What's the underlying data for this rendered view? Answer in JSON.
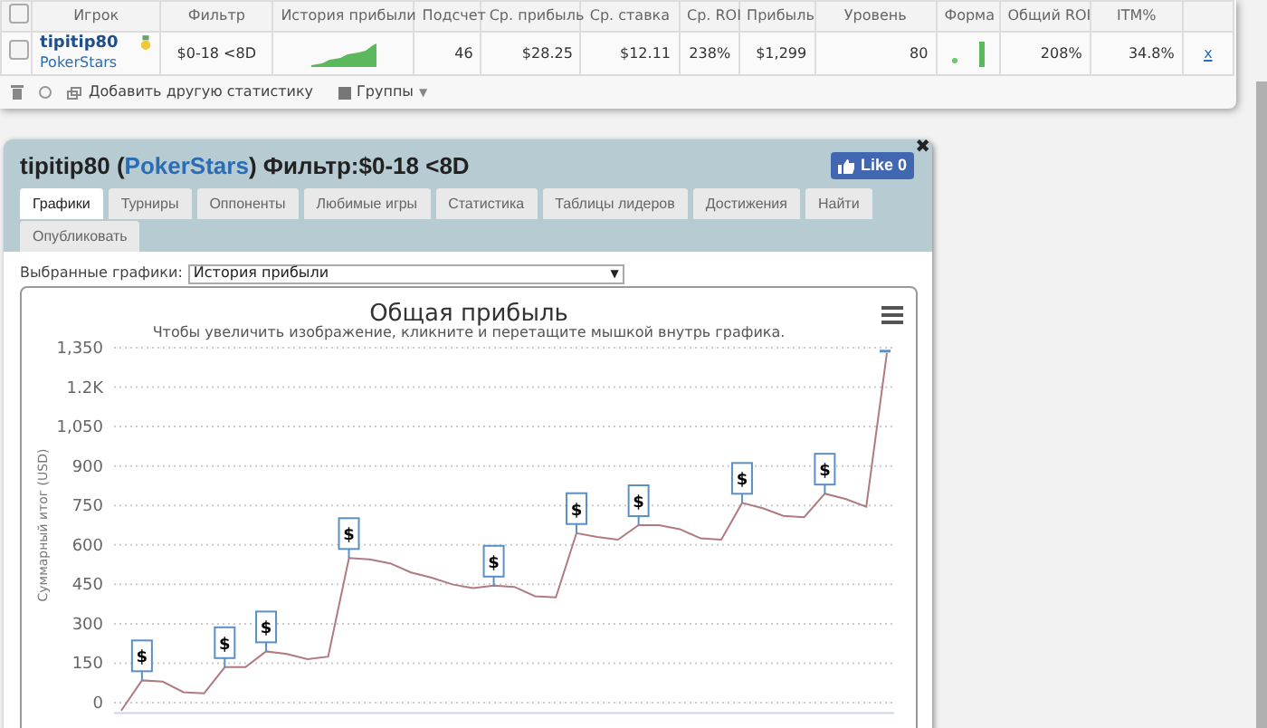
{
  "table": {
    "header_checkbox": {
      "checked": false
    },
    "columns": [
      "Игрок",
      "Фильтр",
      "История прибыли",
      "Подсчет",
      "Ср. прибыль",
      "Ср. ставка",
      "Ср. ROI",
      "Прибыль",
      "Уровень",
      "Форма",
      "Общий ROI",
      "ITM%"
    ],
    "rows": [
      {
        "checked": false,
        "player": "tipitip80",
        "site": "PokerStars",
        "filter": "$0-18 <8D",
        "count": "46",
        "avg_profit": "$28.25",
        "avg_stake": "$12.11",
        "avg_roi": "238%",
        "profit": "$1,299",
        "level": "80",
        "total_roi": "208%",
        "itm": "34.8%",
        "remove": "x"
      }
    ]
  },
  "toolbar": {
    "add_stat": "Добавить другую статистику",
    "groups": "Группы",
    "groups_caret": "▼"
  },
  "panel": {
    "player": "tipitip80",
    "open": " (",
    "site": "PokerStars",
    "close": ")",
    "filter": "Фильтр:$0-18 <8D",
    "like": "Like 0",
    "close_glyph": "✖",
    "tabs": [
      {
        "label": "Графики",
        "selected": true
      },
      {
        "label": "Турниры",
        "selected": false
      },
      {
        "label": "Оппоненты",
        "selected": false
      },
      {
        "label": "Любимые игры",
        "selected": false
      },
      {
        "label": "Статистика",
        "selected": false
      },
      {
        "label": "Таблицы лидеров",
        "selected": false
      },
      {
        "label": "Достижения",
        "selected": false
      },
      {
        "label": "Найти",
        "selected": false
      },
      {
        "label": "Опубликовать",
        "selected": false
      }
    ],
    "chart_select": {
      "label": "Выбранные графики:",
      "value": "История прибыли",
      "caret": "▼"
    },
    "chart": {
      "title": "Общая прибыль",
      "subtitle": "Чтобы увеличить изображение, кликните и перетащите мышкой внутрь графика.",
      "chart_data": {
        "type": "line",
        "ylabel": "Суммарный итог (USD)",
        "grid": true,
        "ylim": [
          -40,
          1350
        ],
        "yticks": [
          0,
          150,
          300,
          450,
          600,
          750,
          900,
          {
            "value": 1050,
            "label": "1,050"
          },
          {
            "value": 1200,
            "label": "1.2K"
          },
          {
            "value": 1350,
            "label": "1,350"
          }
        ],
        "series": [
          {
            "color": "#b07a80",
            "values": [
              -30,
              85,
              80,
              40,
              35,
              135,
              135,
              195,
              185,
              165,
              175,
              550,
              545,
              530,
              495,
              475,
              450,
              435,
              445,
              440,
              405,
              400,
              645,
              630,
              620,
              675,
              675,
              660,
              625,
              620,
              760,
              740,
              710,
              705,
              795,
              775,
              745,
              1330
            ]
          }
        ],
        "annotations": [
          {
            "y": 85,
            "text": "$"
          },
          {
            "y": 135,
            "text": "$"
          },
          {
            "y": 195,
            "text": "$"
          },
          {
            "y": 550,
            "text": "$"
          },
          {
            "y": 445,
            "text": "$"
          },
          {
            "y": 645,
            "text": "$"
          },
          {
            "y": 675,
            "text": "$"
          },
          {
            "y": 760,
            "text": "$"
          },
          {
            "y": 795,
            "text": "$"
          }
        ]
      }
    }
  }
}
